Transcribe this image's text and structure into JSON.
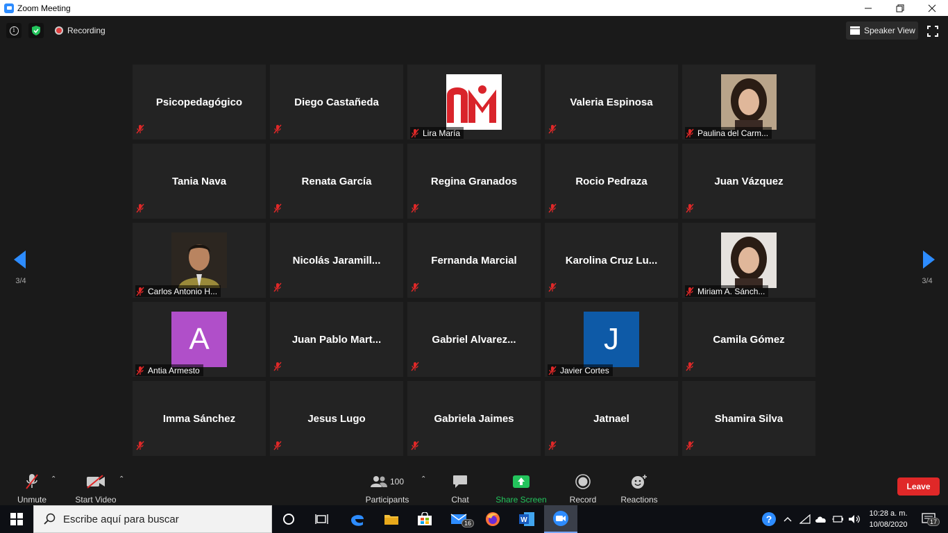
{
  "window": {
    "title": "Zoom Meeting"
  },
  "topbar": {
    "recording_label": "Recording",
    "speaker_view_label": "Speaker View"
  },
  "nav": {
    "page_left": "3/4",
    "page_right": "3/4"
  },
  "tiles": [
    {
      "name": "Psicopedagógico"
    },
    {
      "name": "Diego Castañeda"
    },
    {
      "name": "Lira María",
      "pic": "logo"
    },
    {
      "name": "Valeria Espinosa"
    },
    {
      "name": "Paulina del Carm...",
      "pic": "photo-woman-1"
    },
    {
      "name": "Tania Nava"
    },
    {
      "name": "Renata García"
    },
    {
      "name": "Regina Granados"
    },
    {
      "name": "Rocio Pedraza"
    },
    {
      "name": "Juan Vázquez"
    },
    {
      "name": "Carlos Antonio H...",
      "pic": "photo-man"
    },
    {
      "name": "Nicolás  Jaramill..."
    },
    {
      "name": "Fernanda Marcial"
    },
    {
      "name": "Karolina  Cruz  Lu..."
    },
    {
      "name": "Miriam A. Sánch...",
      "pic": "photo-woman-2"
    },
    {
      "name": "Antia Armesto",
      "pic": "letter",
      "letter": "A",
      "color": "#b04fc9"
    },
    {
      "name": "Juan  Pablo  Mart..."
    },
    {
      "name": "Gabriel  Alvarez..."
    },
    {
      "name": "Javier Cortes",
      "pic": "letter",
      "letter": "J",
      "color": "#0e5aa7"
    },
    {
      "name": "Camila Gómez"
    },
    {
      "name": "Imma Sánchez"
    },
    {
      "name": "Jesus Lugo"
    },
    {
      "name": "Gabriela Jaimes"
    },
    {
      "name": "Jatnael"
    },
    {
      "name": "Shamira Silva"
    }
  ],
  "controls": {
    "unmute_label": "Unmute",
    "start_video_label": "Start Video",
    "participants_label": "Participants",
    "participants_count": "100",
    "chat_label": "Chat",
    "share_screen_label": "Share Screen",
    "record_label": "Record",
    "reactions_label": "Reactions",
    "leave_label": "Leave",
    "share_color": "#23c45c",
    "leave_color": "#e02828"
  },
  "taskbar": {
    "search_placeholder": "Escribe aquí para buscar",
    "mail_badge": "16",
    "time": "10:28 a. m.",
    "date": "10/08/2020",
    "notification_badge": "17"
  }
}
